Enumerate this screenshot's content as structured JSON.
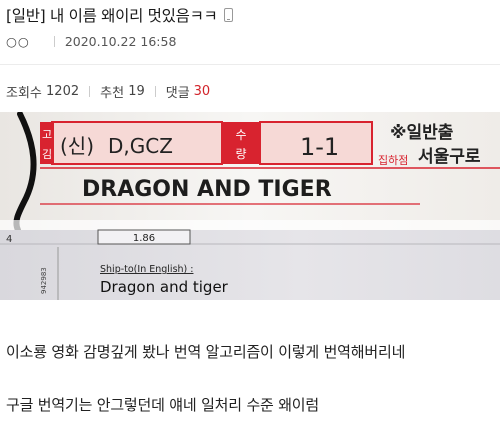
{
  "post": {
    "title": "[일반] 내 이름 왜이리 멋있음ㅋㅋ",
    "author": "○○",
    "date": "2020.10.22 16:58",
    "stats": {
      "views_label": "조회수",
      "views": "1202",
      "likes_label": "추천",
      "likes": "19",
      "comments_label": "댓글",
      "comments": "30"
    },
    "label_photo": {
      "name_prefix": "(신)",
      "name_code": "D,GCZ",
      "side_char_top": "고",
      "side_char_bottom": "김",
      "qty_label_top": "수",
      "qty_label_bottom": "량",
      "qty_value": "1-1",
      "printed_name": "DRAGON AND TIGER",
      "corner_text_top": "※일반출",
      "corner_text_mid": "서울구로",
      "corner_text_red": "집하점",
      "weight": "1.86",
      "left_fragment": "4",
      "barcode_text": "942983",
      "ship_to_label": "Ship-to(In English) :",
      "ship_to_value": "Dragon and tiger"
    },
    "body_lines": [
      "이소룡 영화 감명깊게 봤나 번역 알고리즘이 이렇게 번역해버리네",
      "구글 번역기는 안그렇던데 얘네 일처리 수준 왜이럼"
    ]
  },
  "colors": {
    "comment_accent": "#d2232a",
    "label_red": "#d8232f",
    "label_pink": "#f6d9d6"
  },
  "icons": {
    "device": "mobile-phone-icon"
  }
}
